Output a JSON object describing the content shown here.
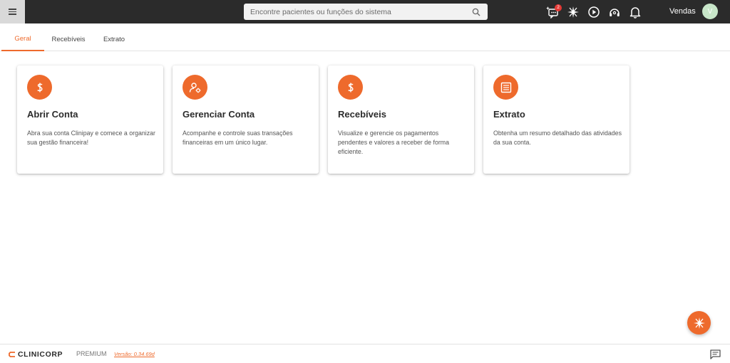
{
  "header": {
    "search_placeholder": "Encontre pacientes ou funções do sistema",
    "notification_badge": "2",
    "user_name": "Vendas",
    "avatar_initial": "V",
    "bg_color": "#2b2b2b"
  },
  "tabs": [
    {
      "label": "Geral",
      "active": true
    },
    {
      "label": "Recebíveis",
      "active": false
    },
    {
      "label": "Extrato",
      "active": false
    }
  ],
  "cards": [
    {
      "icon": "dollar-icon",
      "title": "Abrir Conta",
      "description": "Abra sua conta Clinipay e comece a organizar sua gestão financeira!"
    },
    {
      "icon": "user-settings-icon",
      "title": "Gerenciar Conta",
      "description": "Acompanhe e controle suas transações financeiras em um único lugar."
    },
    {
      "icon": "dollar-icon",
      "title": "Recebíveis",
      "description": "Visualize e gerencie os pagamentos pendentes e valores a receber de forma eficiente."
    },
    {
      "icon": "document-list-icon",
      "title": "Extrato",
      "description": "Obtenha um resumo detalhado das atividades da sua conta."
    }
  ],
  "footer": {
    "logo_text": "CLINICORP",
    "plan": "PREMIUM",
    "version": "Versão: 0.34.69d"
  },
  "colors": {
    "accent": "#ee6a2c",
    "topbar": "#2b2b2b"
  }
}
